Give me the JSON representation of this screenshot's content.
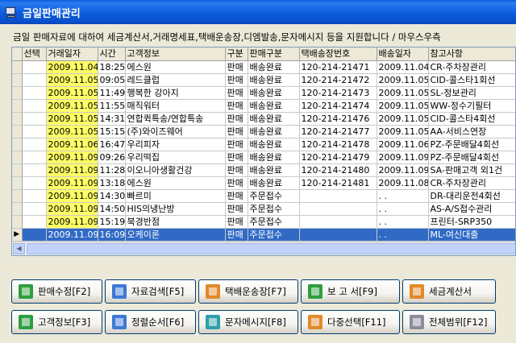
{
  "window": {
    "title": "금일판매관리"
  },
  "description": "금일 판매자료에 대하여 세금계산서,거래명세표,택배운송장,디엠발송,문자메시지 등을 지원합니다 / 마우스우측",
  "grid": {
    "columns": [
      "선택",
      "거래일자",
      "시간",
      "고객정보",
      "구분",
      "판매구분",
      "택배송장번호",
      "배송일자",
      "참고사항"
    ],
    "rows": [
      {
        "select": "",
        "date": "2009.11.04",
        "time": "18:25",
        "customer": "에스원",
        "type": "판매",
        "sale_type": "배송완료",
        "tracking": "120-214-21471",
        "ship_date": "2009.11.04",
        "note": "CR-주차장관리"
      },
      {
        "select": "",
        "date": "2009.11.05",
        "time": "09:05",
        "customer": "레드클럽",
        "type": "판매",
        "sale_type": "배송완료",
        "tracking": "120-214-21472",
        "ship_date": "2009.11.05",
        "note": "CID-콜스타1회선"
      },
      {
        "select": "",
        "date": "2009.11.05",
        "time": "11:49",
        "customer": "행복한 강아지",
        "type": "판매",
        "sale_type": "배송완료",
        "tracking": "120-214-21473",
        "ship_date": "2009.11.05",
        "note": "SL-정보관리"
      },
      {
        "select": "",
        "date": "2009.11.05",
        "time": "11:55",
        "customer": "매직워터",
        "type": "판매",
        "sale_type": "배송완료",
        "tracking": "120-214-21474",
        "ship_date": "2009.11.05",
        "note": "WW-정수기필터"
      },
      {
        "select": "",
        "date": "2009.11.05",
        "time": "14:31",
        "customer": "연합퀵특송/연합특송",
        "type": "판매",
        "sale_type": "배송완료",
        "tracking": "120-214-21476",
        "ship_date": "2009.11.05",
        "note": "CID-콜스타4회선"
      },
      {
        "select": "",
        "date": "2009.11.05",
        "time": "15:15",
        "customer": "(주)와이즈웨어",
        "type": "판매",
        "sale_type": "배송완료",
        "tracking": "120-214-21477",
        "ship_date": "2009.11.05",
        "note": "AA-서비스연장"
      },
      {
        "select": "",
        "date": "2009.11.06",
        "time": "16:47",
        "customer": "우리피자",
        "type": "판매",
        "sale_type": "배송완료",
        "tracking": "120-214-21478",
        "ship_date": "2009.11.06",
        "note": "PZ-주문배달4회선"
      },
      {
        "select": "",
        "date": "2009.11.09",
        "time": "09:26",
        "customer": "우리떡집",
        "type": "판매",
        "sale_type": "배송완료",
        "tracking": "120-214-21479",
        "ship_date": "2009.11.09",
        "note": "PZ-주문배달4회선"
      },
      {
        "select": "",
        "date": "2009.11.09",
        "time": "11:28",
        "customer": "이오니아생활건강",
        "type": "판매",
        "sale_type": "배송완료",
        "tracking": "120-214-21480",
        "ship_date": "2009.11.09",
        "note": "SA-판매고객 외1건"
      },
      {
        "select": "",
        "date": "2009.11.09",
        "time": "13:18",
        "customer": "에스원",
        "type": "판매",
        "sale_type": "배송완료",
        "tracking": "120-214-21481",
        "ship_date": "2009.11.08",
        "note": "CR-주차장관리"
      },
      {
        "select": "",
        "date": "2009.11.09",
        "time": "14:30",
        "customer": "빠르미",
        "type": "판매",
        "sale_type": "주문접수",
        "tracking": "",
        "ship_date": ". .",
        "note": "DR-대리운전4회선"
      },
      {
        "select": "",
        "date": "2009.11.09",
        "time": "14:50",
        "customer": "HIS의냉난방",
        "type": "판매",
        "sale_type": "주문접수",
        "tracking": "",
        "ship_date": ". .",
        "note": "AS-A/S접수관리"
      },
      {
        "select": "",
        "date": "2009.11.09",
        "time": "15:19",
        "customer": "북경반점",
        "type": "판매",
        "sale_type": "주문접수",
        "tracking": "",
        "ship_date": ". .",
        "note": "프린터-SRP350"
      },
      {
        "select": "",
        "date": "2009.11.09",
        "time": "16:09",
        "customer": "오케이론",
        "type": "판매",
        "sale_type": "주문접수",
        "tracking": "",
        "ship_date": ". .",
        "note": "ML-여신대출",
        "selected": true
      }
    ]
  },
  "buttons": {
    "row1": [
      {
        "label": "판매수정[F2]",
        "icon": "edit-icon",
        "color": "green"
      },
      {
        "label": "자료검색[F5]",
        "icon": "search-icon",
        "color": "blue"
      },
      {
        "label": "택배운송장[F7]",
        "icon": "delivery-icon",
        "color": "orange"
      },
      {
        "label": "보 고 서[F9]",
        "icon": "printer-icon",
        "color": "green"
      },
      {
        "label": "세금계산서",
        "icon": "invoice-icon",
        "color": "orange"
      }
    ],
    "row2": [
      {
        "label": "고객정보[F3]",
        "icon": "customer-icon",
        "color": "green"
      },
      {
        "label": "정렬순서[F6]",
        "icon": "sort-icon",
        "color": "blue"
      },
      {
        "label": "문자메시지[F8]",
        "icon": "message-icon",
        "color": "teal"
      },
      {
        "label": "다중선택[F11]",
        "icon": "multi-select-icon",
        "color": "orange"
      },
      {
        "label": "전체범위[F12]",
        "icon": "range-icon",
        "color": "gray"
      }
    ]
  },
  "colors": {
    "titlebar": "#0A5FE0",
    "selection": "#316AC5",
    "date_highlight": "#FFFF66",
    "window_bg": "#ECE9D8"
  }
}
